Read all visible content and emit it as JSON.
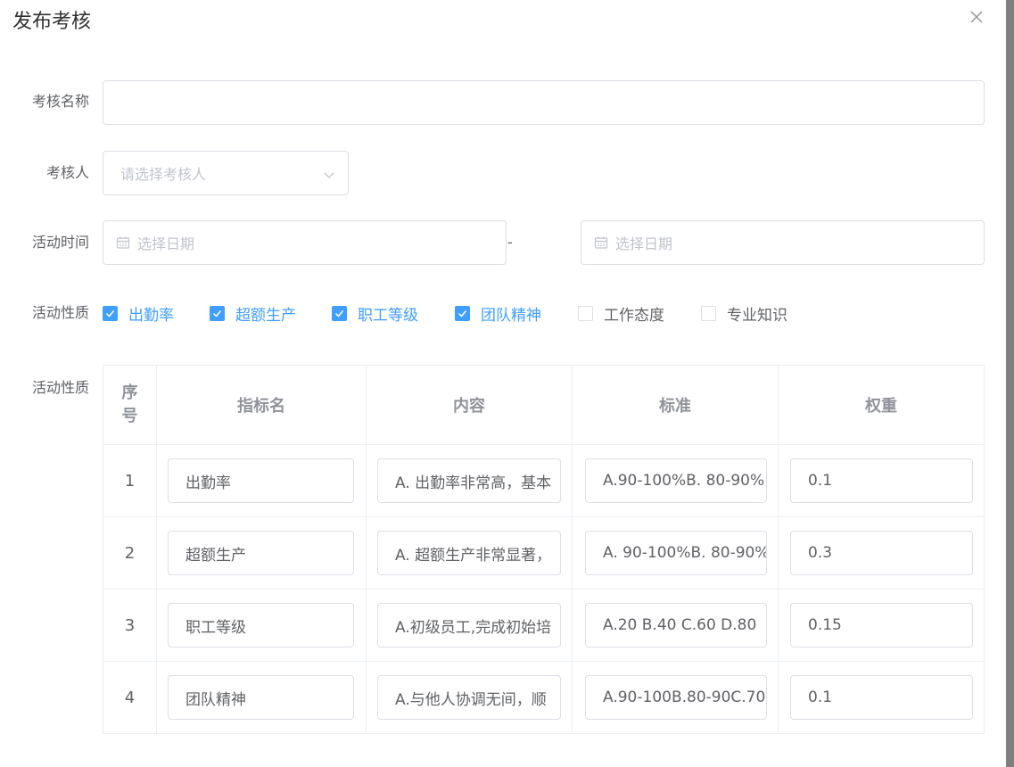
{
  "dialog": {
    "title": "发布考核"
  },
  "form": {
    "name_label": "考核名称",
    "name_value": "",
    "assessor_label": "考核人",
    "assessor_placeholder": "请选择考核人",
    "time_label": "活动时间",
    "start_placeholder": "选择日期",
    "range_separator": "-",
    "end_placeholder": "选择日期",
    "nature_label": "活动性质",
    "table_label": "活动性质",
    "options": [
      {
        "label": "出勤率",
        "checked": true
      },
      {
        "label": "超额生产",
        "checked": true
      },
      {
        "label": "职工等级",
        "checked": true
      },
      {
        "label": "团队精神",
        "checked": true
      },
      {
        "label": "工作态度",
        "checked": false
      },
      {
        "label": "专业知识",
        "checked": false
      }
    ]
  },
  "table": {
    "headers": [
      "序号",
      "指标名",
      "内容",
      "标准",
      "权重"
    ],
    "rows": [
      {
        "seq": "1",
        "name": "出勤率",
        "content": "A. 出勤率非常高，基本",
        "standard": "A.90-100%B. 80-90%",
        "weight": "0.1"
      },
      {
        "seq": "2",
        "name": "超额生产",
        "content": "A. 超额生产非常显著，",
        "standard": "A. 90-100%B. 80-90%",
        "weight": "0.3"
      },
      {
        "seq": "3",
        "name": "职工等级",
        "content": "A.初级员工,完成初始培",
        "standard": "A.20 B.40 C.60 D.80",
        "weight": "0.15"
      },
      {
        "seq": "4",
        "name": "团队精神",
        "content": "A.与他人协调无间，顺",
        "standard": "A.90-100B.80-90C.70",
        "weight": "0.1"
      }
    ]
  },
  "colors": {
    "accent": "#409eff",
    "border": "#dcdfe6",
    "text": "#606266",
    "placeholder": "#c0c4cc",
    "header_text": "#909399"
  }
}
